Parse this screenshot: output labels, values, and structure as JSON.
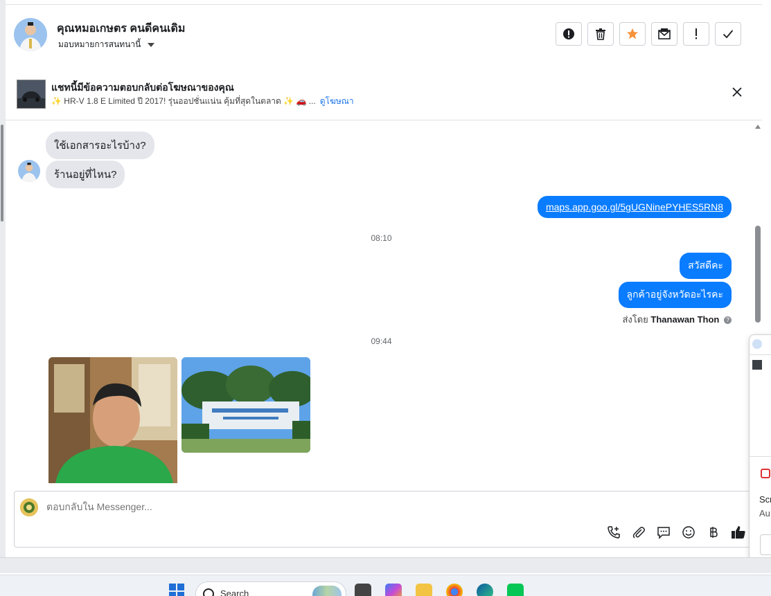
{
  "header": {
    "contact_name": "คุณหมอเกษตร คนดีคนเดิม",
    "assign_label": "มอบหมายการสนทนานี้"
  },
  "ad": {
    "title": "แชทนี้มีข้อความตอบกลับต่อโฆษณาของคุณ",
    "subtitle": "✨ HR-V 1.8 E Limited ปี 2017! รุ่นออปชั่นแน่น คุ้มที่สุดในตลาด ✨ 🚗 ...",
    "link": "ดูโฆษณา"
  },
  "messages": {
    "in1": "ใช้เอกสารอะไรบ้าง?",
    "in2": "ร้านอยู่ที่ไหน?",
    "out_link": "maps.app.goo.gl/5gUGNinePYHES5RN8",
    "time1": "08:10",
    "out1": "สวัสดีคะ",
    "out2": "ลูกค้าอยู่จังหวัดอะไรคะ",
    "sent_by_prefix": "ส่งโดย",
    "sent_by_name": "Thanawan Thon",
    "time2": "09:44"
  },
  "composer": {
    "placeholder": "ตอบกลับใน Messenger..."
  },
  "side_panel": {
    "text1": "Scr",
    "text2": "Au"
  },
  "taskbar": {
    "search_label": "Search"
  },
  "icons": {
    "header_actions": [
      "alert-icon",
      "trash-icon",
      "star-icon",
      "mark-unread-icon",
      "exclamation-icon",
      "check-icon"
    ],
    "composer_tools": [
      "call-add-icon",
      "attach-icon",
      "saved-reply-icon",
      "emoji-icon",
      "payment-icon",
      "like-icon"
    ]
  },
  "colors": {
    "outgoing_bubble": "#0a7cff",
    "incoming_bubble": "#e4e6eb",
    "star": "#f7923a"
  }
}
